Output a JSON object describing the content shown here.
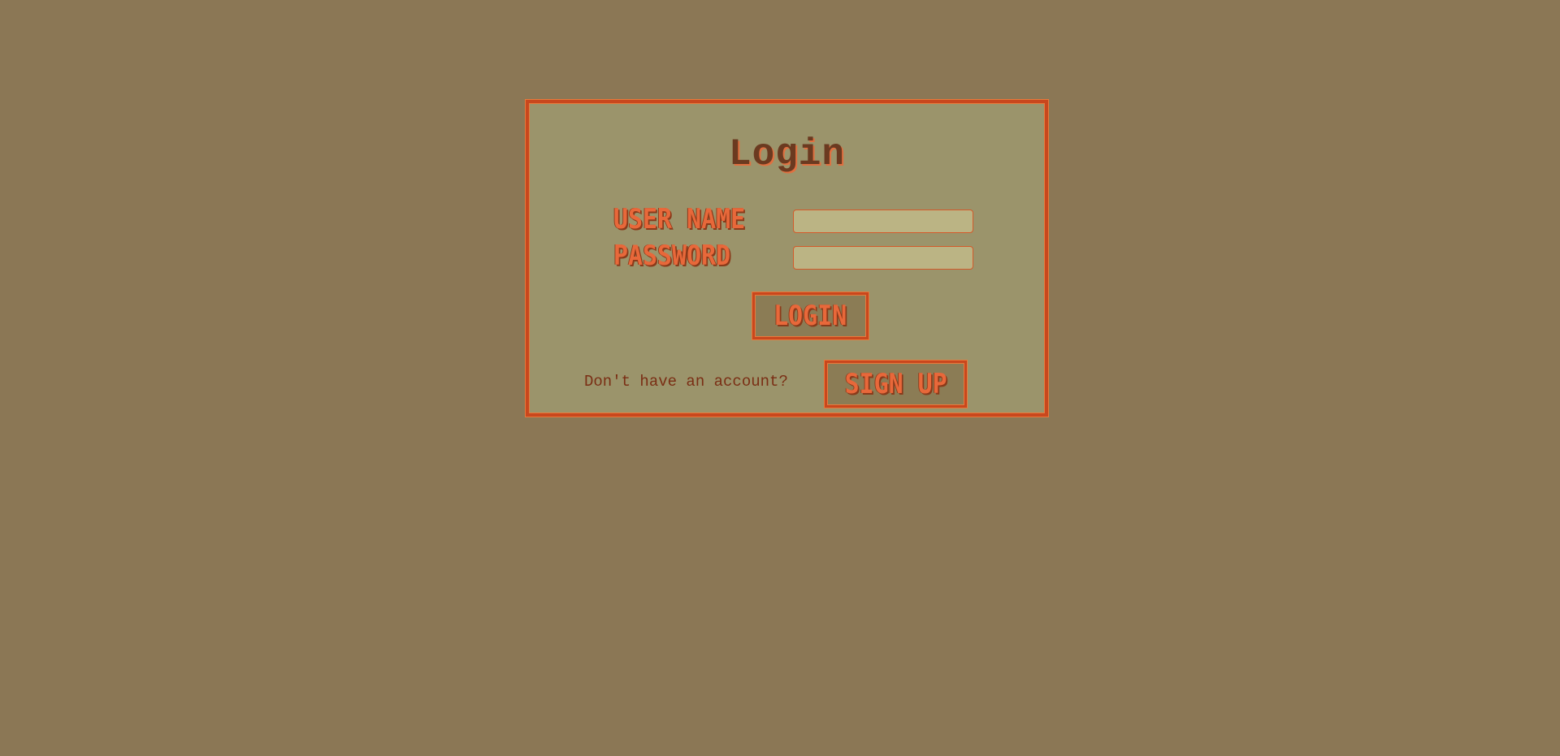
{
  "login_form": {
    "title": "Login",
    "username_label": "USER NAME",
    "username_value": "",
    "password_label": "PASSWORD",
    "password_value": "",
    "login_button_label": "LOGIN",
    "signup_prompt": "Don't have an account?",
    "signup_button_label": "SIGN UP"
  },
  "colors": {
    "page_background": "#8b7755",
    "panel_background": "#9b946b",
    "panel_border": "#c9471d",
    "input_background": "#bbb484",
    "button_background": "#8b7c55",
    "label_text": "#e8683a",
    "title_text": "#6b3a20",
    "prompt_text": "#7a2e14"
  }
}
